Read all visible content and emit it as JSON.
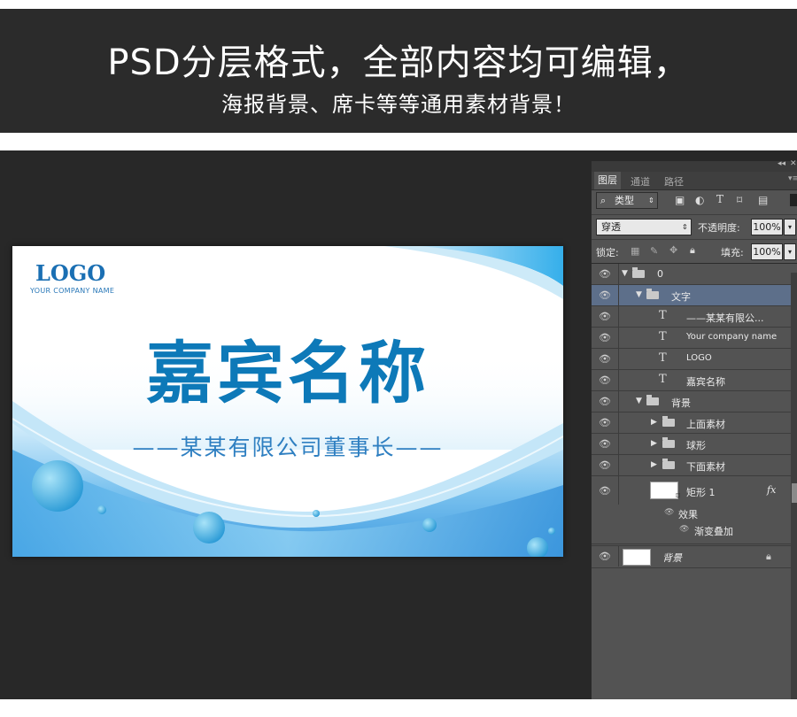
{
  "banner": {
    "title": "PSD分层格式，全部内容均可编辑，",
    "subtitle": "海报背景、席卡等等通用素材背景！"
  },
  "card": {
    "logo": "LOGO",
    "logo_sub": "YOUR COMPANY NAME",
    "guest_name": "嘉宾名称",
    "company_line": "——某某有限公司董事长——",
    "colors": {
      "primary": "#0d79b8",
      "wave_light": "#bfe3f7",
      "wave_dark": "#3fa4e3"
    }
  },
  "panel": {
    "tabs": [
      "图层",
      "通道",
      "路径"
    ],
    "filter": {
      "label": "类型",
      "icons": [
        "image-filter-icon",
        "adjustment-filter-icon",
        "type-filter-icon",
        "shape-filter-icon",
        "smart-object-filter-icon"
      ]
    },
    "blend_mode": "穿透",
    "opacity_label": "不透明度:",
    "opacity_value": "100%",
    "lock_label": "锁定:",
    "fill_label": "填充:",
    "fill_value": "100%",
    "layers": [
      {
        "name": "0",
        "type": "group",
        "indent": 0,
        "expanded": true
      },
      {
        "name": "文字",
        "type": "group",
        "indent": 1,
        "expanded": true,
        "selected": true
      },
      {
        "name": "——某某有限公...",
        "type": "text",
        "indent": 2
      },
      {
        "name": "Your company name",
        "type": "text",
        "indent": 2
      },
      {
        "name": "LOGO",
        "type": "text",
        "indent": 2
      },
      {
        "name": "嘉宾名称",
        "type": "text",
        "indent": 2
      },
      {
        "name": "背景",
        "type": "group",
        "indent": 1,
        "expanded": true
      },
      {
        "name": "上面素材",
        "type": "group",
        "indent": 2,
        "expanded": false
      },
      {
        "name": "球形",
        "type": "group",
        "indent": 2,
        "expanded": false
      },
      {
        "name": "下面素材",
        "type": "group",
        "indent": 2,
        "expanded": false
      },
      {
        "name": "矩形 1",
        "type": "shape",
        "indent": 2,
        "fx": "fx"
      }
    ],
    "effects_label": "效果",
    "gradient_overlay_label": "渐变叠加",
    "background_layer": "背景"
  }
}
